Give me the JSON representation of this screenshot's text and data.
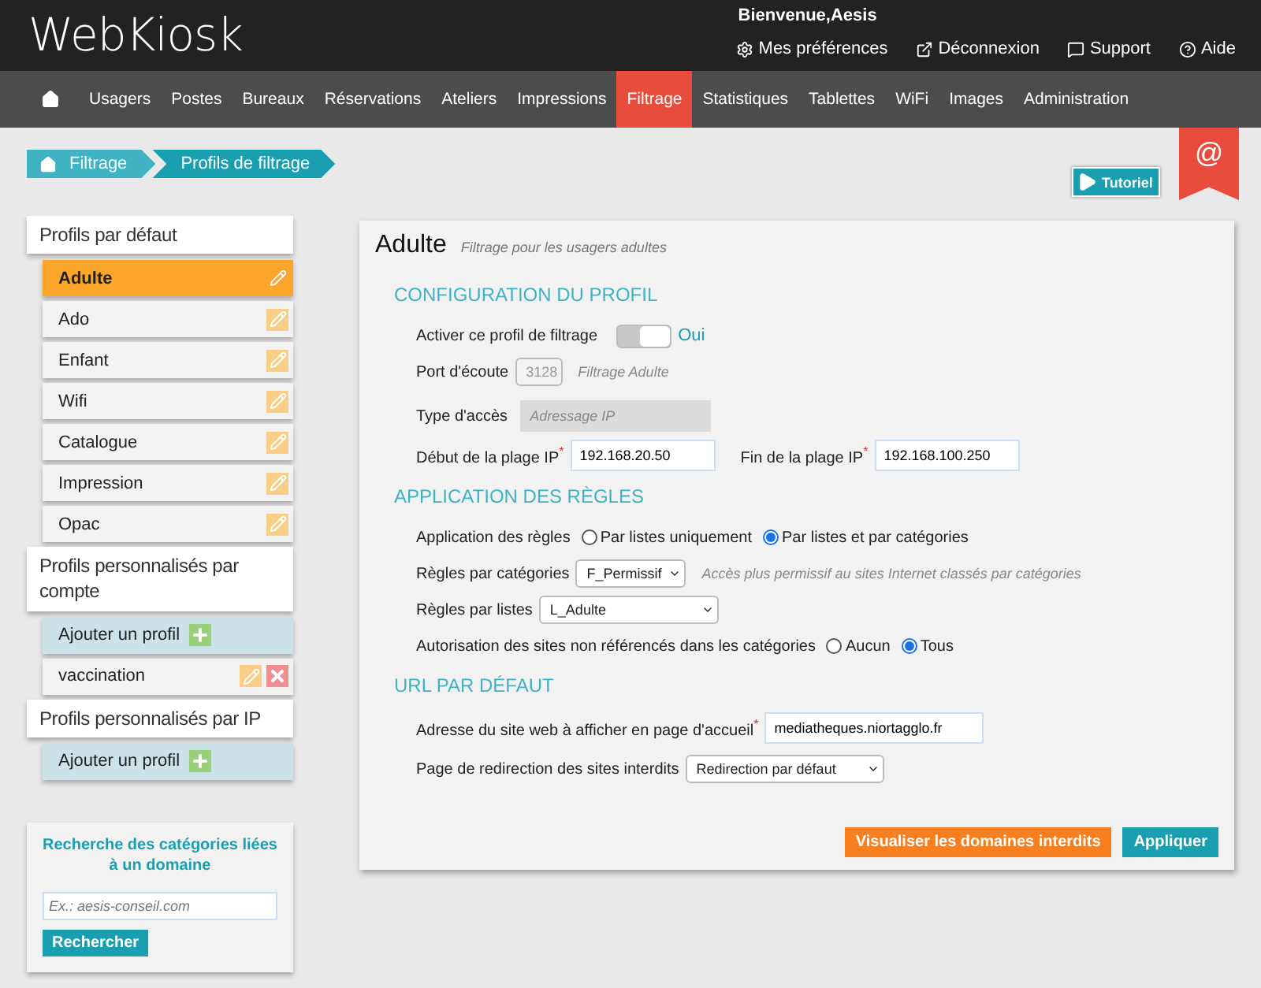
{
  "header": {
    "logo": "WebKiosk",
    "welcome": "Bienvenue,Aesis",
    "links": [
      {
        "label": "Mes préférences"
      },
      {
        "label": "Déconnexion"
      },
      {
        "label": "Support"
      },
      {
        "label": "Aide"
      }
    ]
  },
  "nav": {
    "items": [
      {
        "kind": "home",
        "selected": false
      },
      {
        "label": "Usagers",
        "selected": false
      },
      {
        "label": "Postes",
        "selected": false
      },
      {
        "label": "Bureaux",
        "selected": false
      },
      {
        "label": "Réservations",
        "selected": false
      },
      {
        "label": "Ateliers",
        "selected": false
      },
      {
        "label": "Impressions",
        "selected": false
      },
      {
        "label": "Filtrage",
        "selected": true
      },
      {
        "label": "Statistiques",
        "selected": false
      },
      {
        "label": "Tablettes",
        "selected": false
      },
      {
        "label": "WiFi",
        "selected": false
      },
      {
        "label": "Images",
        "selected": false
      },
      {
        "label": "Administration",
        "selected": false
      }
    ]
  },
  "breadcrumb": [
    "Filtrage",
    "Profils de filtrage"
  ],
  "tutorial": {
    "label": "Tutoriel"
  },
  "ribbon": {
    "symbol": "@"
  },
  "sidebar": {
    "groups": [
      {
        "title": "Profils par défaut",
        "items": [
          {
            "kind": "profile",
            "label": "Adulte",
            "selected": true
          },
          {
            "kind": "profile",
            "label": "Ado",
            "selected": false
          },
          {
            "kind": "profile",
            "label": "Enfant",
            "selected": false
          },
          {
            "kind": "profile",
            "label": "Wifi",
            "selected": false
          },
          {
            "kind": "profile",
            "label": "Catalogue",
            "selected": false
          },
          {
            "kind": "profile",
            "label": "Impression",
            "selected": false
          },
          {
            "kind": "profile",
            "label": "Opac",
            "selected": false
          }
        ]
      },
      {
        "title": "Profils personnalisés par compte",
        "items": [
          {
            "kind": "add",
            "label": "Ajouter un profil"
          },
          {
            "kind": "custom",
            "label": "vaccination",
            "selected": false
          }
        ]
      },
      {
        "title": "Profils personnalisés par IP",
        "items": [
          {
            "kind": "add",
            "label": "Ajouter un profil"
          }
        ]
      }
    ]
  },
  "search_box": {
    "title": "Recherche des catégories liées à un domaine",
    "placeholder": "Ex.: aesis-conseil.com",
    "button": "Rechercher"
  },
  "panel": {
    "title": "Adulte",
    "subtitle": "Filtrage pour les usagers adultes",
    "config": {
      "heading": "CONFIGURATION DU PROFIL",
      "activate": {
        "label": "Activer ce profil de filtrage",
        "on": true,
        "value": "Oui"
      },
      "port": {
        "label": "Port d'écoute",
        "value": "3128",
        "note": "Filtrage Adulte"
      },
      "access": {
        "label": "Type d'accès",
        "placeholder": "Adressage IP"
      },
      "ip_start": {
        "label": "Début de la plage IP",
        "required_mark": "*",
        "value": "192.168.20.50"
      },
      "ip_end": {
        "label": "Fin de la plage IP",
        "required_mark": "*",
        "value": "192.168.100.250"
      }
    },
    "rules": {
      "heading": "APPLICATION DES RÈGLES",
      "application": {
        "label": "Application des règles",
        "options": [
          {
            "label": "Par listes uniquement",
            "selected": false
          },
          {
            "label": "Par listes et par catégories",
            "selected": true
          }
        ]
      },
      "categories": {
        "label": "Règles par catégories",
        "value": "F_Permissif",
        "note": "Accès plus permissif au sites Internet classés par catégories"
      },
      "lists": {
        "label": "Règles par listes",
        "value": "L_Adulte"
      },
      "unreferenced": {
        "label": "Autorisation des sites non référencés dans les catégories",
        "options": [
          {
            "label": "Aucun",
            "selected": false
          },
          {
            "label": "Tous",
            "selected": true
          }
        ]
      }
    },
    "url": {
      "heading": "URL PAR DÉFAUT",
      "homepage": {
        "label": "Adresse du site web à afficher en page d'accueil",
        "required_mark": "*",
        "value": "mediatheques.niortagglo.fr"
      },
      "redirect": {
        "label": "Page de redirection des sites interdits",
        "value": "Redirection par défaut"
      }
    },
    "buttons": [
      {
        "kind": "warning",
        "label": "Visualiser les domaines interdits"
      },
      {
        "kind": "primary",
        "label": "Appliquer"
      }
    ]
  }
}
